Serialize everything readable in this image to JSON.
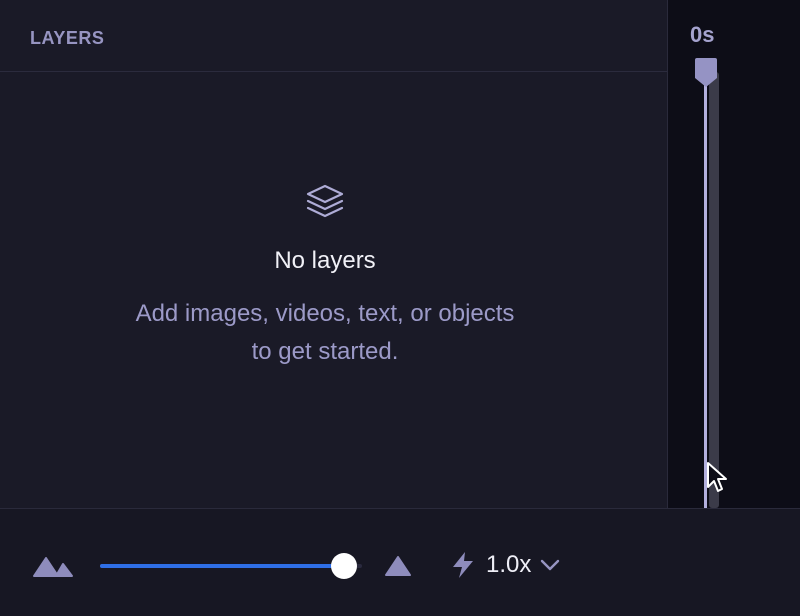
{
  "layers_panel": {
    "title": "LAYERS",
    "empty_state": {
      "icon": "layers-stack-icon",
      "title": "No layers",
      "description": "Add images, videos, text, or objects to get started."
    }
  },
  "timeline": {
    "time_label": "0s"
  },
  "toolbar": {
    "zoom_out_icon": "mountains-icon",
    "zoom_in_icon": "triangle-icon",
    "zoom_level_fraction": 0.93,
    "speed_icon": "bolt-icon",
    "speed_value": "1.0x",
    "speed_dropdown_icon": "chevron-down-icon"
  },
  "colors": {
    "accent": "#2f6fe7",
    "muted_text": "#9c9ac8",
    "panel_bg": "#1a1a27",
    "timeline_bg": "#0d0d17"
  }
}
